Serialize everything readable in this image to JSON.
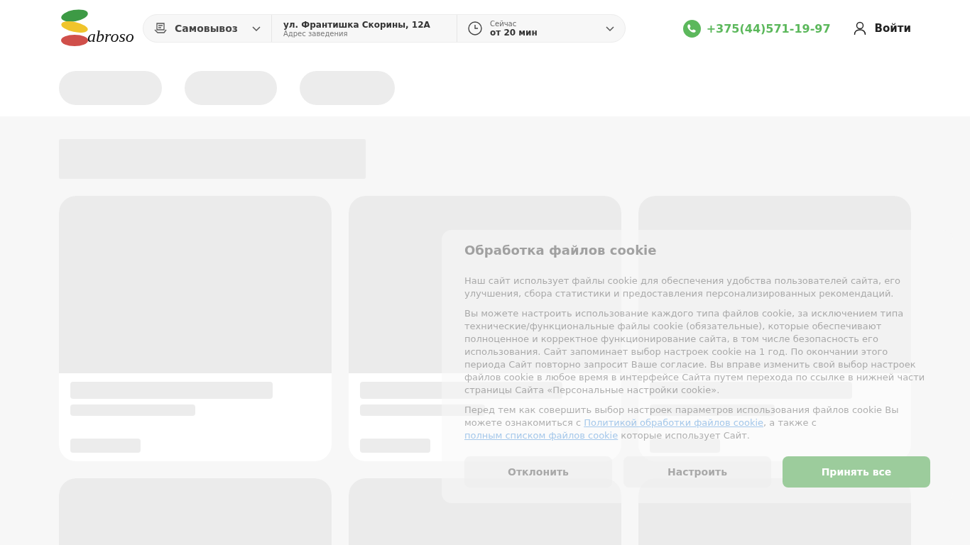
{
  "header": {
    "logo_text": "abroso",
    "delivery": {
      "label": "Самовывоз"
    },
    "address": {
      "value": "ул. Франтишка Скорины, 12А",
      "label": "Адрес заведения"
    },
    "time": {
      "label": "Сейчас",
      "value": "от 20 мин"
    },
    "phone": "+375(44)571-19-97",
    "login": "Войти"
  },
  "cookie_dialog": {
    "title": "Обработка файлов cookie",
    "paragraphs": [
      "Наш сайт использует файлы cookie для обеспечения удобства пользователей сайта, его улучшения, сбора статистики и предоставления персонализированных рекомендаций.",
      "Вы можете настроить использование каждого типа файлов cookie, за исключением типа технические/функциональные файлы cookie (обязательные), которые обеспечивают полноценное и корректное функционирование сайта, в том числе безопасность его использования. Сайт запоминает выбор настроек cookie на 1 год. По окончании этого периода Сайт повторно запросит Ваше согласие. Вы вправе изменить свой выбор настроек файлов cookie в любое время в интерфейсе Сайта путем перехода по ссылке в нижней части страницы Сайта «Персональные настройки cookie»."
    ],
    "last_paragraph": [
      {
        "kind": "text",
        "text": "Перед тем как совершить выбор настроек параметров использования файлов cookie Вы можете ознакомиться с "
      },
      {
        "kind": "link",
        "text": "Политикой обработки файлов cookie"
      },
      {
        "kind": "text",
        "text": ", а также с "
      },
      {
        "kind": "link",
        "text": "полным списком файлов cookie"
      },
      {
        "kind": "text",
        "text": " которые использует Сайт."
      }
    ],
    "buttons": [
      {
        "label": "Отклонить",
        "kind": "plain"
      },
      {
        "label": "Настроить",
        "kind": "plain"
      },
      {
        "label": "Принять все",
        "kind": "primary"
      }
    ]
  }
}
